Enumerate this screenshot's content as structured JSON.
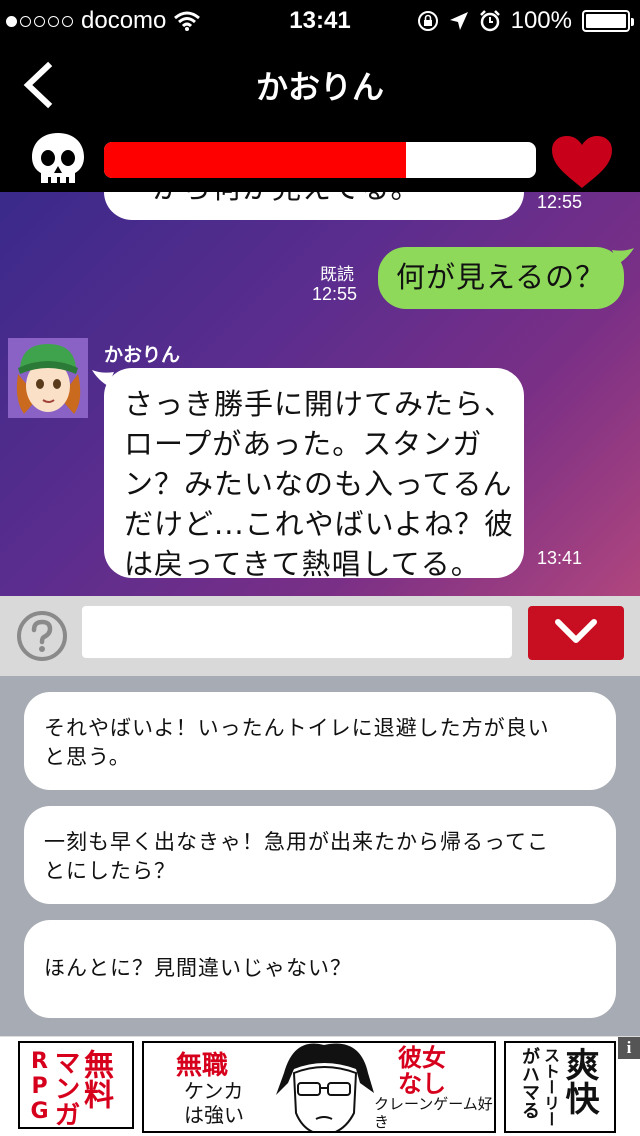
{
  "status_bar": {
    "carrier": "docomo",
    "time": "13:41",
    "battery": "100%",
    "signal_dots_filled": 1,
    "signal_dots_total": 5
  },
  "nav": {
    "title": "かおりん",
    "back_icon": "chevron-left-icon"
  },
  "meter": {
    "left_icon": "skull-icon",
    "right_icon": "heart-icon",
    "fill_fraction": 0.7,
    "fill_color": "#ff0000"
  },
  "chat": {
    "messages": [
      {
        "side": "left",
        "text": "ーから何か見えてる。",
        "time": "12:55"
      },
      {
        "side": "right",
        "text": "何が見えるの？",
        "read": "既読",
        "time": "12:55"
      },
      {
        "side": "left",
        "sender": "かおりん",
        "lines": [
          "さっき勝手に開けてみたら、",
          "ロープがあった。スタンガ",
          "ン？みたいなのも入ってるん",
          "だけど...これやばいよね？彼",
          "は戻ってきて熱唱してる。"
        ],
        "time": "13:41"
      }
    ]
  },
  "input": {
    "help_icon": "question-circle-icon",
    "value": "",
    "placeholder": "",
    "send_icon": "chevron-down-icon"
  },
  "options": [
    {
      "lines": [
        "それやばいよ！いったんトイレに退避した方が良い",
        "と思う。"
      ]
    },
    {
      "lines": [
        "一刻も早く出なきゃ！急用が出来たから帰るってこ",
        "とにしたら？"
      ]
    },
    {
      "lines": [
        "ほんとに？見間違いじゃない？"
      ]
    }
  ],
  "ad": {
    "left_col1": "RPG",
    "left_col2": "マンガ",
    "left_col3": "無料",
    "mid_tag1": "無職",
    "mid_tag2": "ケンカは強い",
    "mid_tag3": "彼女なし",
    "mid_tag4": "クレーンゲーム好き",
    "right_col1": "がハマる",
    "right_col2": "ストーリー",
    "right_col3": "爽快",
    "info": "i"
  }
}
